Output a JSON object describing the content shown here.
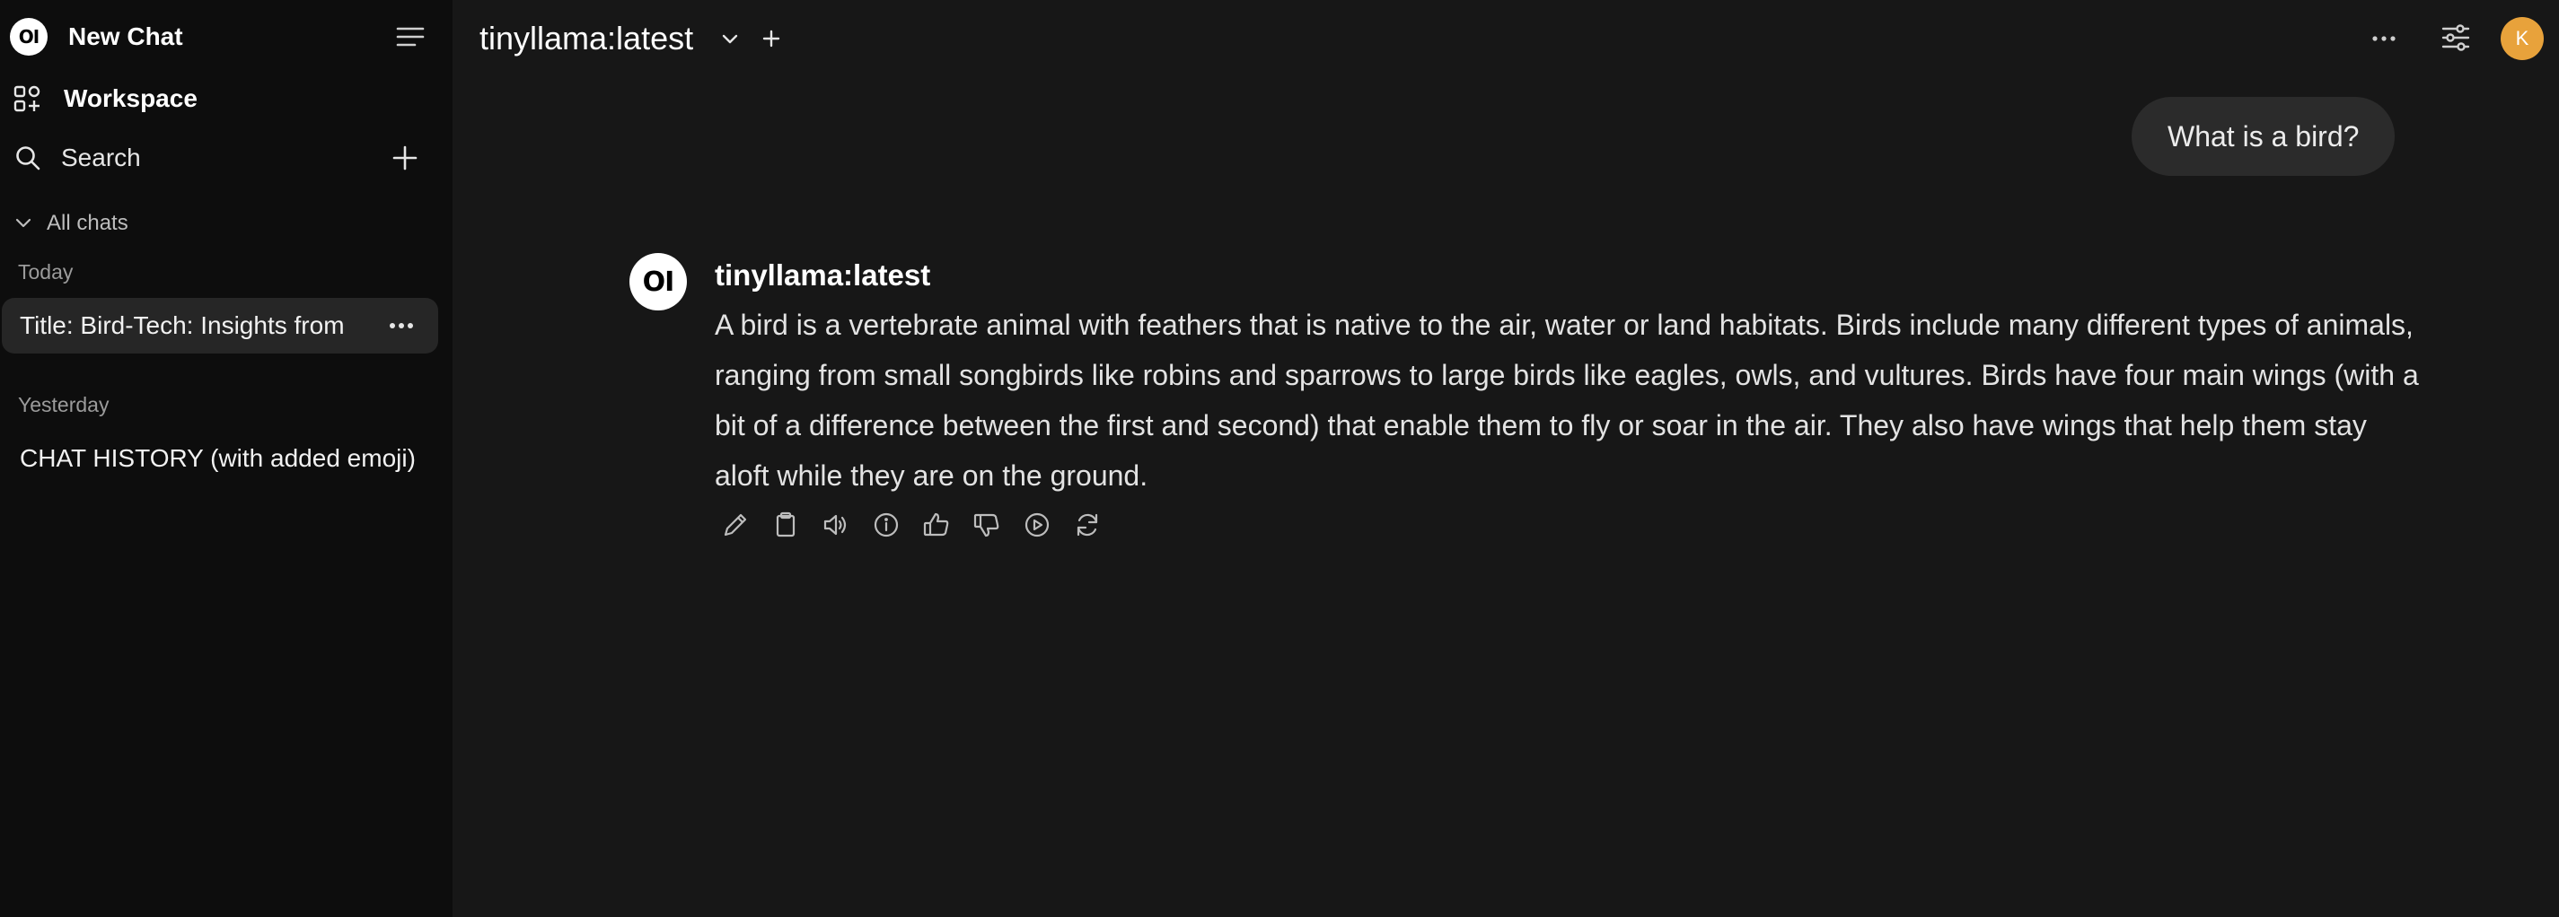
{
  "sidebar": {
    "logo_text": "OI",
    "new_chat_label": "New Chat",
    "workspace_label": "Workspace",
    "search_label": "Search",
    "all_chats_label": "All chats",
    "sections": [
      {
        "label": "Today",
        "chats": [
          {
            "title": "Title: Bird-Tech: Insights from",
            "active": true
          }
        ]
      },
      {
        "label": "Yesterday",
        "chats": [
          {
            "title": "CHAT HISTORY (with added emoji)",
            "active": false
          }
        ]
      }
    ],
    "icons": {
      "menu": "sidebar-menu-icon",
      "workspace": "workspace-grid-icon",
      "search": "search-icon",
      "new": "plus-icon",
      "collapse": "chevron-down-icon",
      "more": "more-dots-icon"
    }
  },
  "header": {
    "model_name": "tinyllama:latest",
    "avatar_initial": "K",
    "avatar_color": "#e8a23b",
    "icons": [
      "chevron-down-icon",
      "plus-icon",
      "more-dots-icon",
      "sliders-icon"
    ]
  },
  "conversation": {
    "user_message": "What is a bird?",
    "assistant": {
      "logo_text": "OI",
      "name": "tinyllama:latest",
      "message": "A bird is a vertebrate animal with feathers that is native to the air, water or land habitats. Birds include many different types of animals, ranging from small songbirds like robins and sparrows to large birds like eagles, owls, and vultures. Birds have four main wings (with a bit of a difference between the first and second) that enable them to fly or soar in the air. They also have wings that help them stay aloft while they are on the ground."
    },
    "action_icons": [
      "edit-icon",
      "copy-icon",
      "read-aloud-icon",
      "info-icon",
      "thumbs-up-icon",
      "thumbs-down-icon",
      "continue-icon",
      "regenerate-icon"
    ]
  },
  "colors": {
    "sidebar_bg": "#0d0d0d",
    "main_bg": "#171717",
    "active_chat_bg": "#262626",
    "user_bubble_bg": "#2b2b2b",
    "accent_avatar": "#e8a23b"
  }
}
